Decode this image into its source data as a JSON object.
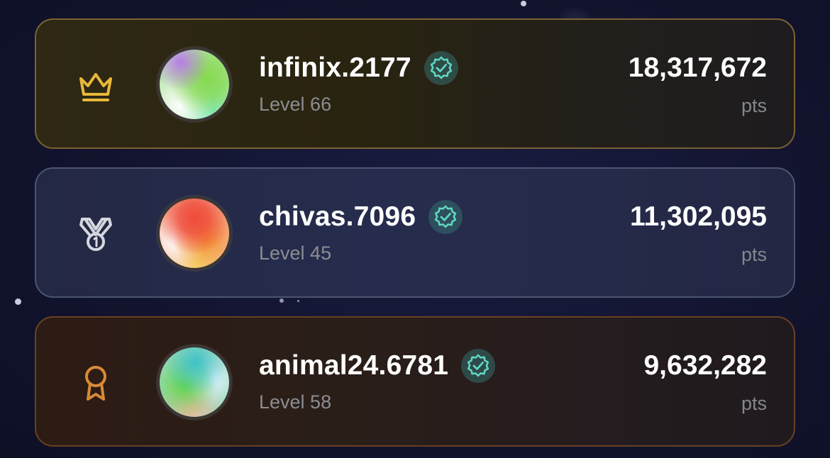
{
  "colors": {
    "gold": "#e8b83a",
    "silver": "#d5d7de",
    "bronze": "#d98a36",
    "verified": "#5fd6c4"
  },
  "leaderboard": [
    {
      "rank_icon": "crown-icon",
      "avatar_style": "green-gradient",
      "username": "infinix.2177",
      "verified_icon": "verified-badge-icon",
      "level": "Level 66",
      "points": "18,317,672",
      "points_unit": "pts"
    },
    {
      "rank_icon": "medal-icon",
      "avatar_style": "red-orange-gradient",
      "username": "chivas.7096",
      "verified_icon": "verified-badge-icon",
      "level": "Level 45",
      "points": "11,302,095",
      "points_unit": "pts"
    },
    {
      "rank_icon": "award-ribbon-icon",
      "avatar_style": "multicolor-gradient",
      "username": "animal24.6781",
      "verified_icon": "verified-badge-icon",
      "level": "Level 58",
      "points": "9,632,282",
      "points_unit": "pts"
    }
  ]
}
